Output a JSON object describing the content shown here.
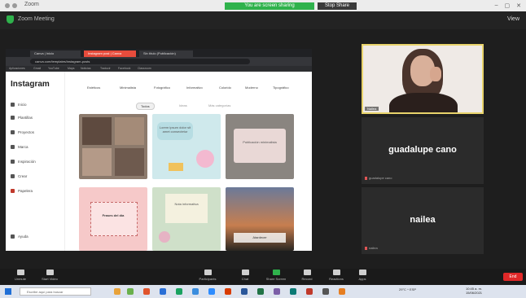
{
  "window": {
    "title": "Zoom",
    "share_banner": "You are screen sharing",
    "stop_share": "Stop Share",
    "controls": [
      "–",
      "▢",
      "✕"
    ]
  },
  "zoom_header": {
    "label": "Zoom Meeting",
    "view": "View"
  },
  "browser": {
    "tabs": [
      "Canva | Inicio",
      "Instagram post | Canva",
      "Sin título (Publicación)"
    ],
    "url": "canva.com/templates/instagram-posts",
    "bookmarks": [
      "Aplicaciones",
      "Gmail",
      "YouTube",
      "Maps",
      "Noticias",
      "Traducir",
      "Facebook",
      "Classroom"
    ]
  },
  "canva": {
    "brand": "Instagram",
    "sidebar": [
      "Inicio",
      "Plantillas",
      "Proyectos",
      "Marca",
      "Inspiración",
      "Crear",
      "Papelera"
    ],
    "categories": [
      "Estéticos",
      "Minimalista",
      "Fotográfico",
      "Informativo",
      "Colorido",
      "Moderno",
      "Tipográfico"
    ],
    "chips": {
      "active": "Todos",
      "second": "Ideas",
      "third": "Más categorías"
    },
    "cards": [
      {
        "caption": ""
      },
      {
        "caption": "Lorem ipsum dolor sit amet consectetur"
      },
      {
        "caption": "Publicación minimalista"
      },
      {
        "caption": "Frases del día"
      },
      {
        "caption": "Nota informativa"
      },
      {
        "caption": "Atardecer"
      }
    ],
    "bottom": "Ayuda"
  },
  "participants": [
    {
      "name": "",
      "tag": "Nailea"
    },
    {
      "name": "guadalupe cano",
      "tag": "guadalupe cano"
    },
    {
      "name": "nailea",
      "tag": "nailea"
    }
  ],
  "toolbar": [
    "Unmute",
    "Start Video",
    "Participants",
    "Chat",
    "Share Screen",
    "Record",
    "Reactions",
    "Apps"
  ],
  "end_button": "End",
  "taskbar": {
    "search": "Escribe aquí para buscar",
    "tray": "29°C  ^  ESP",
    "time": "10:45 a. m.",
    "date": "15/06/2021"
  },
  "colors": {
    "accent": "#2fb24c",
    "end": "#e02828",
    "active_tab": "#e74c3c"
  }
}
